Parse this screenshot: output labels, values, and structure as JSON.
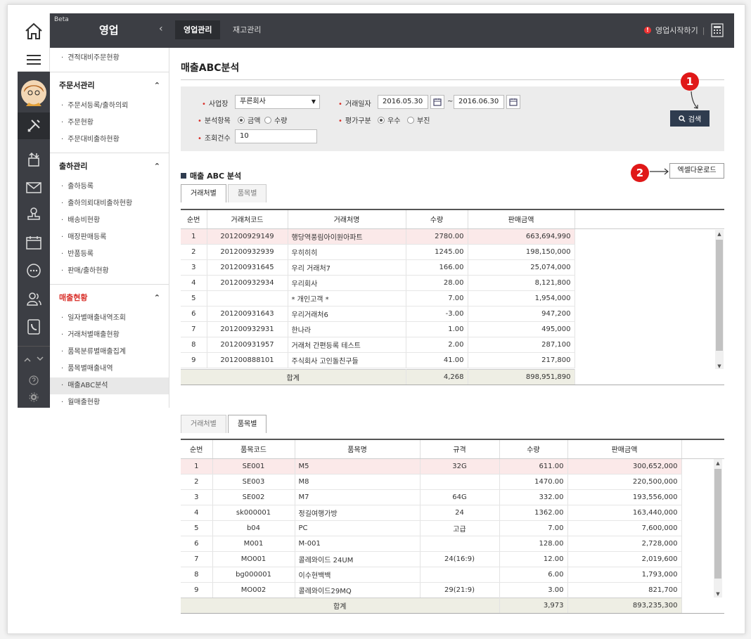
{
  "header": {
    "beta": "Beta",
    "title": "영업",
    "tabs": [
      "영업관리",
      "재고관리"
    ],
    "start_label": "영업시작하기",
    "alert_glyph": "!"
  },
  "menu": {
    "top_item": "견적대비주문현황",
    "sections": [
      {
        "title": "주문서관리",
        "items": [
          "주문서등록/출하의뢰",
          "주문현황",
          "주문대비출하현황"
        ]
      },
      {
        "title": "출하관리",
        "items": [
          "출하등록",
          "출하의뢰대비출하현황",
          "배송비현황",
          "매장판매등록",
          "반품등록",
          "판매/출하현황"
        ]
      },
      {
        "title": "매출현황",
        "items": [
          "일자별매출내역조회",
          "거래처별매출현황",
          "품목분류별매출집계",
          "품목별매출내역",
          "매출ABC분석",
          "월매출현황"
        ]
      }
    ],
    "selected": "매출ABC분석"
  },
  "page": {
    "title": "매출ABC분석"
  },
  "search": {
    "site_label": "사업장",
    "site_value": "푸른회사",
    "date_label": "거래일자",
    "date_from": "2016.05.30",
    "date_to": "2016.06.30",
    "tilde": "~",
    "item_label": "분석항목",
    "item_opts": [
      "금액",
      "수량"
    ],
    "eval_label": "평가구분",
    "eval_opts": [
      "우수",
      "부진"
    ],
    "count_label": "조회건수",
    "count_value": "10",
    "req_mark": "•",
    "search_btn": "검색"
  },
  "annotations": {
    "b1": "1",
    "b2": "2"
  },
  "section": {
    "title": "매출 ABC 분석",
    "excel_btn": "엑셀다운로드"
  },
  "tabs1": [
    "거래처별",
    "품목별"
  ],
  "table1": {
    "headers": [
      "순번",
      "거래처코드",
      "거래처명",
      "수량",
      "판매금액"
    ],
    "rows": [
      [
        "1",
        "201200929149",
        "행당역풍림아이원아파트",
        "2780.00",
        "663,694,990"
      ],
      [
        "2",
        "201200932939",
        "우히히히",
        "1245.00",
        "198,150,000"
      ],
      [
        "3",
        "201200931645",
        "우리 거래처7",
        "166.00",
        "25,074,000"
      ],
      [
        "4",
        "201200932934",
        "우리회사",
        "28.00",
        "8,121,800"
      ],
      [
        "5",
        "",
        "* 개인고객 *",
        "7.00",
        "1,954,000"
      ],
      [
        "6",
        "201200931643",
        "우리거래처6",
        "-3.00",
        "947,200"
      ],
      [
        "7",
        "201200932931",
        "한나라",
        "1.00",
        "495,000"
      ],
      [
        "8",
        "201200931957",
        "거래처 간편등록 테스트",
        "2.00",
        "287,100"
      ],
      [
        "9",
        "201200888101",
        "주식회사 고인돌친구들",
        "41.00",
        "217,800"
      ]
    ],
    "total_label": "합계",
    "total_qty": "4,268",
    "total_amt": "898,951,890"
  },
  "tabs2": [
    "거래처별",
    "품목별"
  ],
  "table2": {
    "headers": [
      "순번",
      "품목코드",
      "품목명",
      "규격",
      "수량",
      "판매금액"
    ],
    "rows": [
      [
        "1",
        "SE001",
        "M5",
        "32G",
        "611.00",
        "300,652,000"
      ],
      [
        "2",
        "SE003",
        "M8",
        "",
        "1470.00",
        "220,500,000"
      ],
      [
        "3",
        "SE002",
        "M7",
        "64G",
        "332.00",
        "193,556,000"
      ],
      [
        "4",
        "sk000001",
        "정길여행가방",
        "24",
        "1362.00",
        "163,440,000"
      ],
      [
        "5",
        "b04",
        "PC",
        "고급",
        "7.00",
        "7,600,000"
      ],
      [
        "6",
        "M001",
        "M-001",
        "",
        "128.00",
        "2,728,000"
      ],
      [
        "7",
        "MO001",
        "콜레와이드 24UM",
        "24(16:9)",
        "12.00",
        "2,019,600"
      ],
      [
        "8",
        "bg000001",
        "이수현백백",
        "",
        "6.00",
        "1,793,000"
      ],
      [
        "9",
        "MO002",
        "콜레와이드29MQ",
        "29(21:9)",
        "3.00",
        "821,700"
      ]
    ],
    "total_label": "합계",
    "total_qty": "3,973",
    "total_amt": "893,235,300"
  },
  "colors": {
    "accent": "#d9302a",
    "dark": "#3c3e44",
    "button": "#2f3c4f",
    "highlight": "#fbe9e9"
  }
}
